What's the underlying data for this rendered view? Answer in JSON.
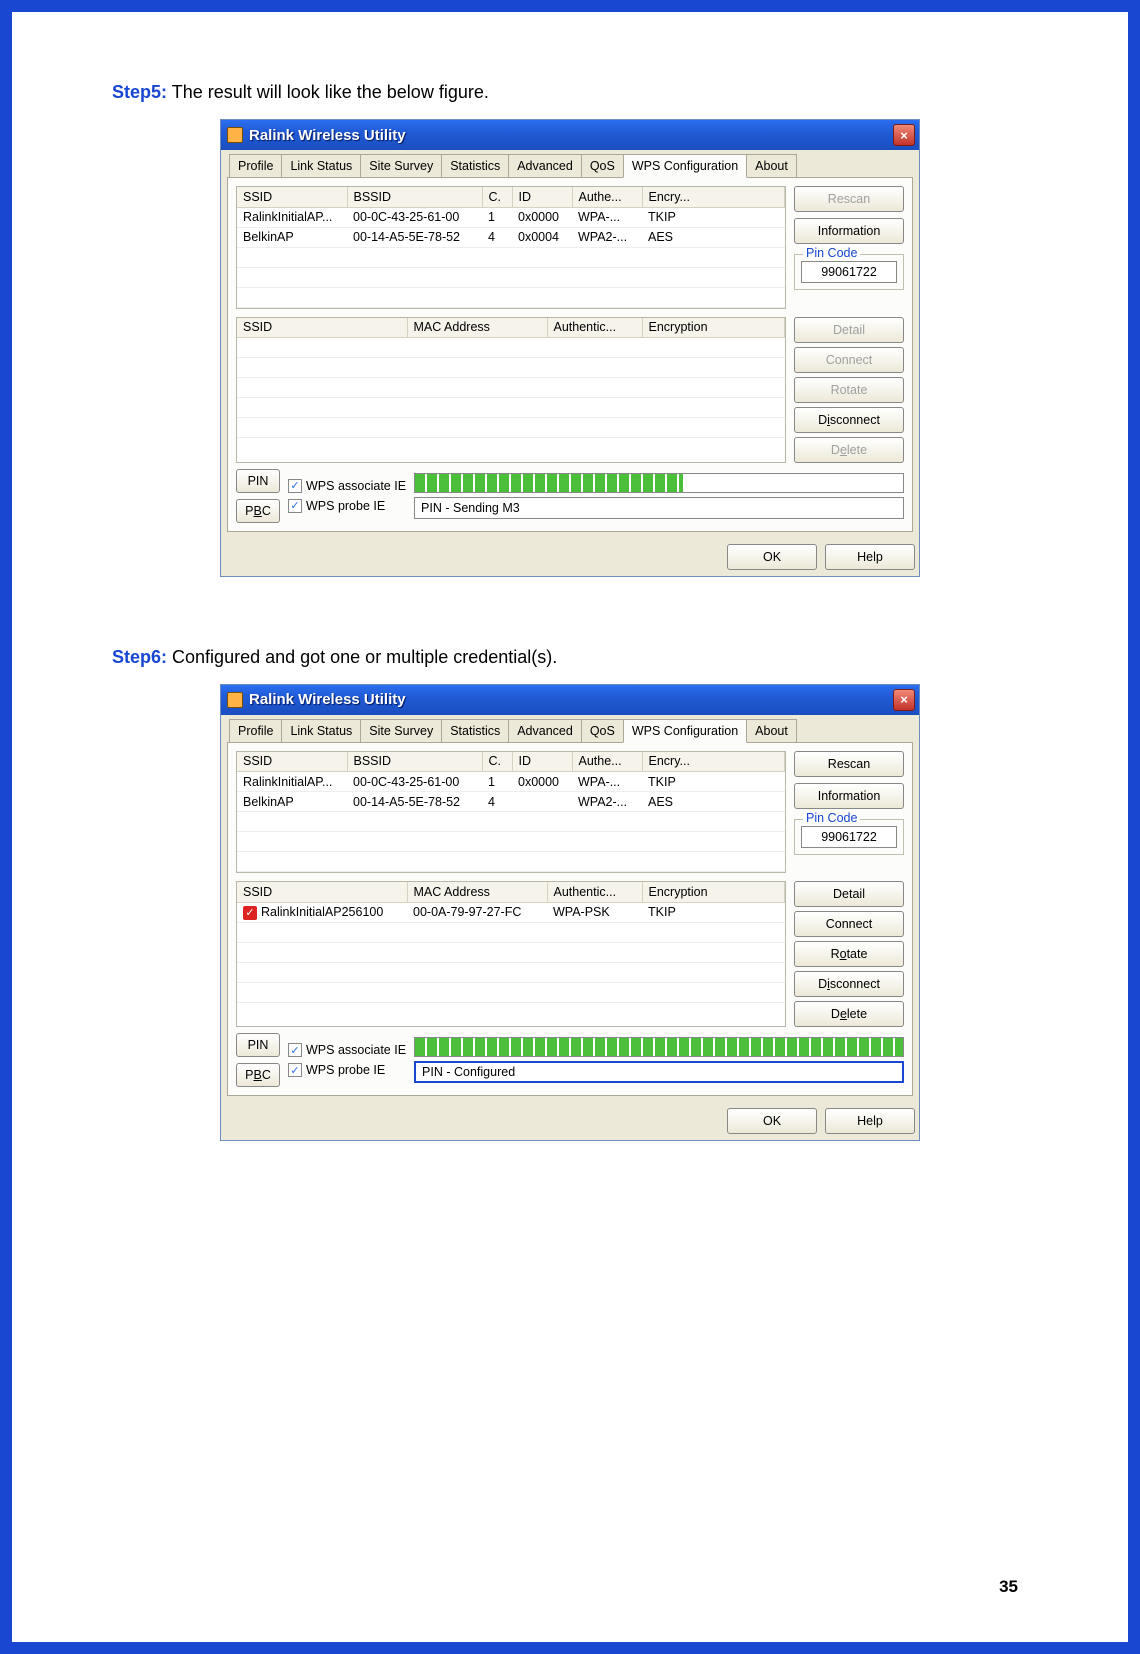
{
  "page_number": "35",
  "step5": {
    "label": "Step5:",
    "text": "The result will look like the below figure."
  },
  "step6": {
    "label": "Step6:",
    "text": "Configured and got one or multiple credential(s)."
  },
  "win": {
    "title": "Ralink Wireless Utility",
    "tabs": [
      "Profile",
      "Link Status",
      "Site Survey",
      "Statistics",
      "Advanced",
      "QoS",
      "WPS Configuration",
      "About"
    ],
    "active_tab": "WPS Configuration",
    "table1_headers": [
      "SSID",
      "BSSID",
      "C.",
      "ID",
      "Authe...",
      "Encry..."
    ],
    "table2_headers": [
      "SSID",
      "MAC Address",
      "Authentic...",
      "Encryption"
    ],
    "buttons": {
      "rescan": "Rescan",
      "information": "Information",
      "pin_code_legend": "Pin Code",
      "pin_code": "99061722",
      "detail": "Detail",
      "connect": "Connect",
      "rotate": "Rotate",
      "disconnect": "Disconnect",
      "delete": "Delete",
      "pin": "PIN",
      "pbc": "PBC",
      "wps_assoc": "WPS associate IE",
      "wps_probe": "WPS probe IE",
      "ok": "OK",
      "help": "Help"
    }
  },
  "fig1": {
    "rows_top": [
      {
        "ssid": "RalinkInitialAP...",
        "bssid": "00-0C-43-25-61-00",
        "c": "1",
        "id": "0x0000",
        "auth": "WPA-...",
        "enc": "TKIP"
      },
      {
        "ssid": "BelkinAP",
        "bssid": "00-14-A5-5E-78-52",
        "c": "4",
        "id": "0x0004",
        "auth": "WPA2-...",
        "enc": "AES"
      }
    ],
    "rows_bottom": [],
    "progress_pct": 55,
    "status": "PIN - Sending M3",
    "side_top": {
      "rescan_disabled": true
    },
    "side_bottom": {
      "detail_disabled": true,
      "connect_disabled": true,
      "rotate_disabled": true,
      "disconnect_disabled": false,
      "delete_disabled": true
    }
  },
  "fig2": {
    "rows_top": [
      {
        "ssid": "RalinkInitialAP...",
        "bssid": "00-0C-43-25-61-00",
        "c": "1",
        "id": "0x0000",
        "auth": "WPA-...",
        "enc": "TKIP"
      },
      {
        "ssid": "BelkinAP",
        "bssid": "00-14-A5-5E-78-52",
        "c": "4",
        "id": "",
        "auth": "WPA2-...",
        "enc": "AES"
      }
    ],
    "rows_bottom": [
      {
        "ssid": "RalinkInitialAP256100",
        "mac": "00-0A-79-97-27-FC",
        "auth": "WPA-PSK",
        "enc": "TKIP",
        "checked": true
      }
    ],
    "progress_pct": 100,
    "status": "PIN - Configured",
    "side_top": {
      "rescan_disabled": false
    },
    "side_bottom": {
      "detail_disabled": false,
      "connect_disabled": false,
      "rotate_disabled": false,
      "disconnect_disabled": false,
      "delete_disabled": false
    },
    "status_hilite": true
  }
}
